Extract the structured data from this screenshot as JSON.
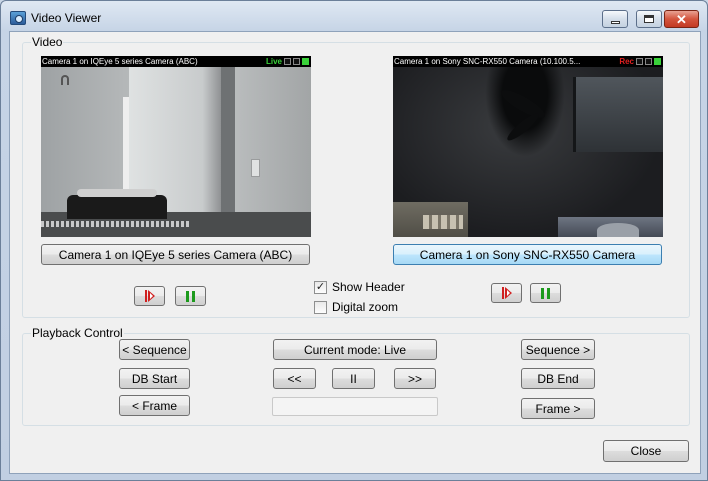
{
  "window": {
    "title": "Video Viewer",
    "minimize_icon": "minimize-icon",
    "maximize_icon": "maximize-icon",
    "close_glyph": "✕"
  },
  "video_group": {
    "label": "Video",
    "camera1": {
      "header": "Camera 1 on IQEye 5 series Camera (ABC)",
      "status": "Live",
      "button_label": "Camera 1 on IQEye 5 series Camera (ABC)"
    },
    "camera2": {
      "header": "Camera 1 on Sony SNC-RX550 Camera (10.100.5...",
      "status": "Rec",
      "button_label": "Camera 1 on Sony SNC-RX550 Camera"
    },
    "show_header": {
      "label": "Show Header",
      "checked": true,
      "mark": "✓"
    },
    "digital_zoom": {
      "label": "Digital zoom",
      "checked": false,
      "mark": ""
    }
  },
  "playback": {
    "label": "Playback Control",
    "sequence_prev": "< Sequence",
    "current_mode": "Current mode: Live",
    "sequence_next": "Sequence >",
    "db_start": "DB Start",
    "rewind": "<<",
    "pause": "II",
    "fast_forward": ">>",
    "db_end": "DB End",
    "frame_prev": "< Frame",
    "frame_next": "Frame >",
    "progress_text": ""
  },
  "footer": {
    "close_label": "Close"
  }
}
